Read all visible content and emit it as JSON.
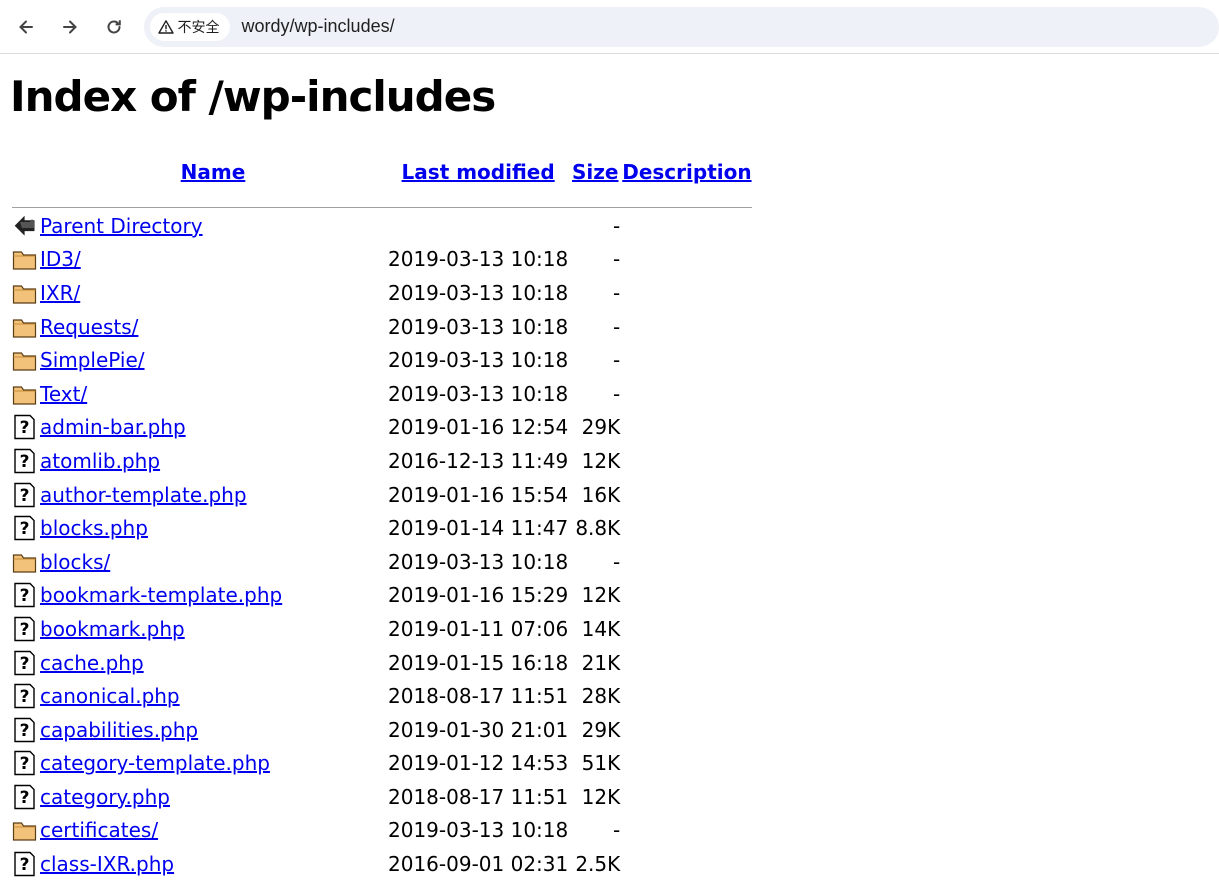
{
  "browser": {
    "security_label": "不安全",
    "url": "wordy/wp-includes/"
  },
  "page": {
    "title": "Index of /wp-includes"
  },
  "table": {
    "headers": {
      "name": "Name",
      "last_modified": "Last modified",
      "size": "Size",
      "description": "Description"
    },
    "rows": [
      {
        "icon": "back-icon",
        "name": "Parent Directory",
        "date": "",
        "size": "-"
      },
      {
        "icon": "folder-icon",
        "name": "ID3/",
        "date": "2019-03-13 10:18",
        "size": "-"
      },
      {
        "icon": "folder-icon",
        "name": "IXR/",
        "date": "2019-03-13 10:18",
        "size": "-"
      },
      {
        "icon": "folder-icon",
        "name": "Requests/",
        "date": "2019-03-13 10:18",
        "size": "-"
      },
      {
        "icon": "folder-icon",
        "name": "SimplePie/",
        "date": "2019-03-13 10:18",
        "size": "-"
      },
      {
        "icon": "folder-icon",
        "name": "Text/",
        "date": "2019-03-13 10:18",
        "size": "-"
      },
      {
        "icon": "unknown-file-icon",
        "name": "admin-bar.php",
        "date": "2019-01-16 12:54",
        "size": "29K"
      },
      {
        "icon": "unknown-file-icon",
        "name": "atomlib.php",
        "date": "2016-12-13 11:49",
        "size": "12K"
      },
      {
        "icon": "unknown-file-icon",
        "name": "author-template.php",
        "date": "2019-01-16 15:54",
        "size": "16K"
      },
      {
        "icon": "unknown-file-icon",
        "name": "blocks.php",
        "date": "2019-01-14 11:47",
        "size": "8.8K"
      },
      {
        "icon": "folder-icon",
        "name": "blocks/",
        "date": "2019-03-13 10:18",
        "size": "-"
      },
      {
        "icon": "unknown-file-icon",
        "name": "bookmark-template.php",
        "date": "2019-01-16 15:29",
        "size": "12K"
      },
      {
        "icon": "unknown-file-icon",
        "name": "bookmark.php",
        "date": "2019-01-11 07:06",
        "size": "14K"
      },
      {
        "icon": "unknown-file-icon",
        "name": "cache.php",
        "date": "2019-01-15 16:18",
        "size": "21K"
      },
      {
        "icon": "unknown-file-icon",
        "name": "canonical.php",
        "date": "2018-08-17 11:51",
        "size": "28K"
      },
      {
        "icon": "unknown-file-icon",
        "name": "capabilities.php",
        "date": "2019-01-30 21:01",
        "size": "29K"
      },
      {
        "icon": "unknown-file-icon",
        "name": "category-template.php",
        "date": "2019-01-12 14:53",
        "size": "51K"
      },
      {
        "icon": "unknown-file-icon",
        "name": "category.php",
        "date": "2018-08-17 11:51",
        "size": "12K"
      },
      {
        "icon": "folder-icon",
        "name": "certificates/",
        "date": "2019-03-13 10:18",
        "size": "-"
      },
      {
        "icon": "unknown-file-icon",
        "name": "class-IXR.php",
        "date": "2016-09-01 02:31",
        "size": "2.5K"
      }
    ]
  },
  "colors": {
    "link": "#0000ee",
    "folder": "#f3c27a"
  }
}
